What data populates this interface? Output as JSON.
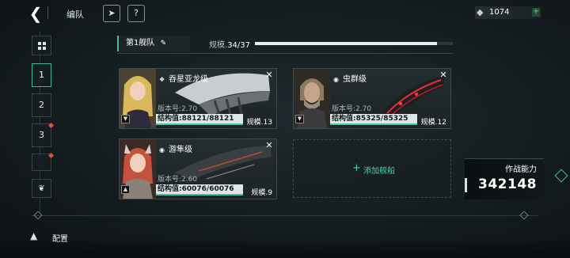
{
  "header": {
    "title": "编队",
    "back_icon": "chevron-left-icon",
    "currency_value": "1074"
  },
  "sidebar": {
    "tabs": [
      "1",
      "2",
      "3",
      ""
    ],
    "active_tab": "1"
  },
  "fleet": {
    "tab_label": "第1舰队",
    "scale_label": "规模.",
    "scale_value": "34/37",
    "scale_fraction": 0.919
  },
  "ships": [
    {
      "class_name": "吞星亚龙级",
      "version": "版本号:2.70",
      "hp_text": "结构值:88121/88121",
      "hp_fraction": 1.0,
      "scale": "规模.13"
    },
    {
      "class_name": "虫群级",
      "version": "版本号:2.70",
      "hp_text": "结构值:85325/85325",
      "hp_fraction": 1.0,
      "scale": "规模.12"
    },
    {
      "class_name": "游隼级",
      "version": "版本号:2.60",
      "hp_text": "结构值:60076/60076",
      "hp_fraction": 1.0,
      "scale": "规模.9"
    }
  ],
  "add_ship_label": "添加舰船",
  "power": {
    "label": "作战能力",
    "value": "342148"
  },
  "bottom": {
    "config_label": "配置"
  },
  "colors": {
    "accent": "#43c2a0",
    "alert": "#e2532c"
  }
}
